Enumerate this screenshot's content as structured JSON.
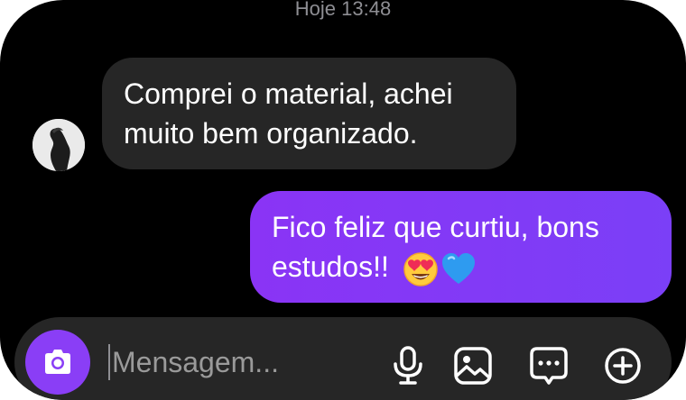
{
  "thread": {
    "timestamp": "Hoje 13:48"
  },
  "messages": [
    {
      "direction": "incoming",
      "lines": [
        "Comprei o material, achei",
        "muito bem organizado."
      ]
    },
    {
      "direction": "outgoing",
      "lines": [
        "Fico feliz que curtiu, bons",
        "estudos!!"
      ],
      "emoji": [
        "heart-eyes-emoji",
        "blue-heart-emoji"
      ]
    }
  ],
  "composer": {
    "placeholder": "Mensagem...",
    "icons": [
      "camera-icon",
      "microphone-icon",
      "image-icon",
      "sticker-icon",
      "add-icon"
    ]
  },
  "colors": {
    "background": "#000000",
    "incoming_bubble": "#262626",
    "outgoing_bubble": "#8a34f5",
    "accent": "#8a3ef6",
    "timestamp": "#8e8e93"
  }
}
